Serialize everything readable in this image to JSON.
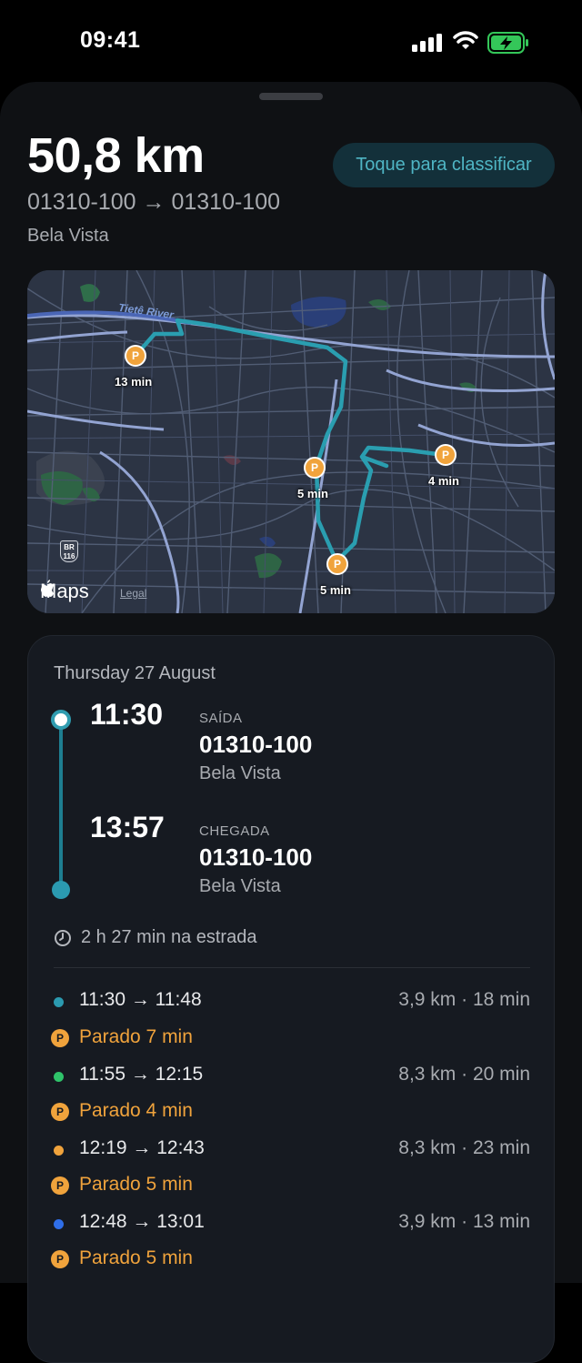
{
  "status_bar": {
    "time": "09:41"
  },
  "trip": {
    "distance": "50,8 km",
    "route": "01310-100 → 01310-100",
    "neighborhood": "Bela Vista",
    "rate_label": "Toque para classificar"
  },
  "map": {
    "logo": "Maps",
    "legal": "Legal",
    "river": "Tietê River",
    "shield_top": "BR",
    "shield_bottom": "116",
    "stops": [
      {
        "label": "13 min",
        "glyph": "P"
      },
      {
        "label": "5 min",
        "glyph": "P"
      },
      {
        "label": "4 min",
        "glyph": "P"
      },
      {
        "label": "5 min",
        "glyph": "P"
      }
    ]
  },
  "details": {
    "date": "Thursday 27 August",
    "departure": {
      "time": "11:30",
      "tag": "SAÍDA",
      "zip": "01310-100",
      "place": "Bela Vista"
    },
    "arrival": {
      "time": "13:57",
      "tag": "CHEGADA",
      "zip": "01310-100",
      "place": "Bela Vista"
    },
    "duration": "2 h 27 min na estrada",
    "segments": [
      {
        "time": "11:30 → 11:48",
        "stats": "3,9 km · 18 min",
        "color": "#2b9ab0"
      },
      {
        "time": "11:55 → 12:15",
        "stats": "8,3 km · 20 min",
        "color": "#2fc36a"
      },
      {
        "time": "12:19 → 12:43",
        "stats": "8,3 km · 23 min",
        "color": "#f0a33c"
      },
      {
        "time": "12:48 → 13:01",
        "stats": "3,9 km · 13 min",
        "color": "#2f6ee8"
      }
    ],
    "stops": [
      {
        "text": "Parado 7 min",
        "glyph": "P"
      },
      {
        "text": "Parado 4 min",
        "glyph": "P"
      },
      {
        "text": "Parado 5 min",
        "glyph": "P"
      },
      {
        "text": "Parado 5 min",
        "glyph": "P"
      }
    ]
  },
  "colors": {
    "accent": "#2b9ab0",
    "stop": "#f0a33c",
    "background": "#0f1114"
  }
}
